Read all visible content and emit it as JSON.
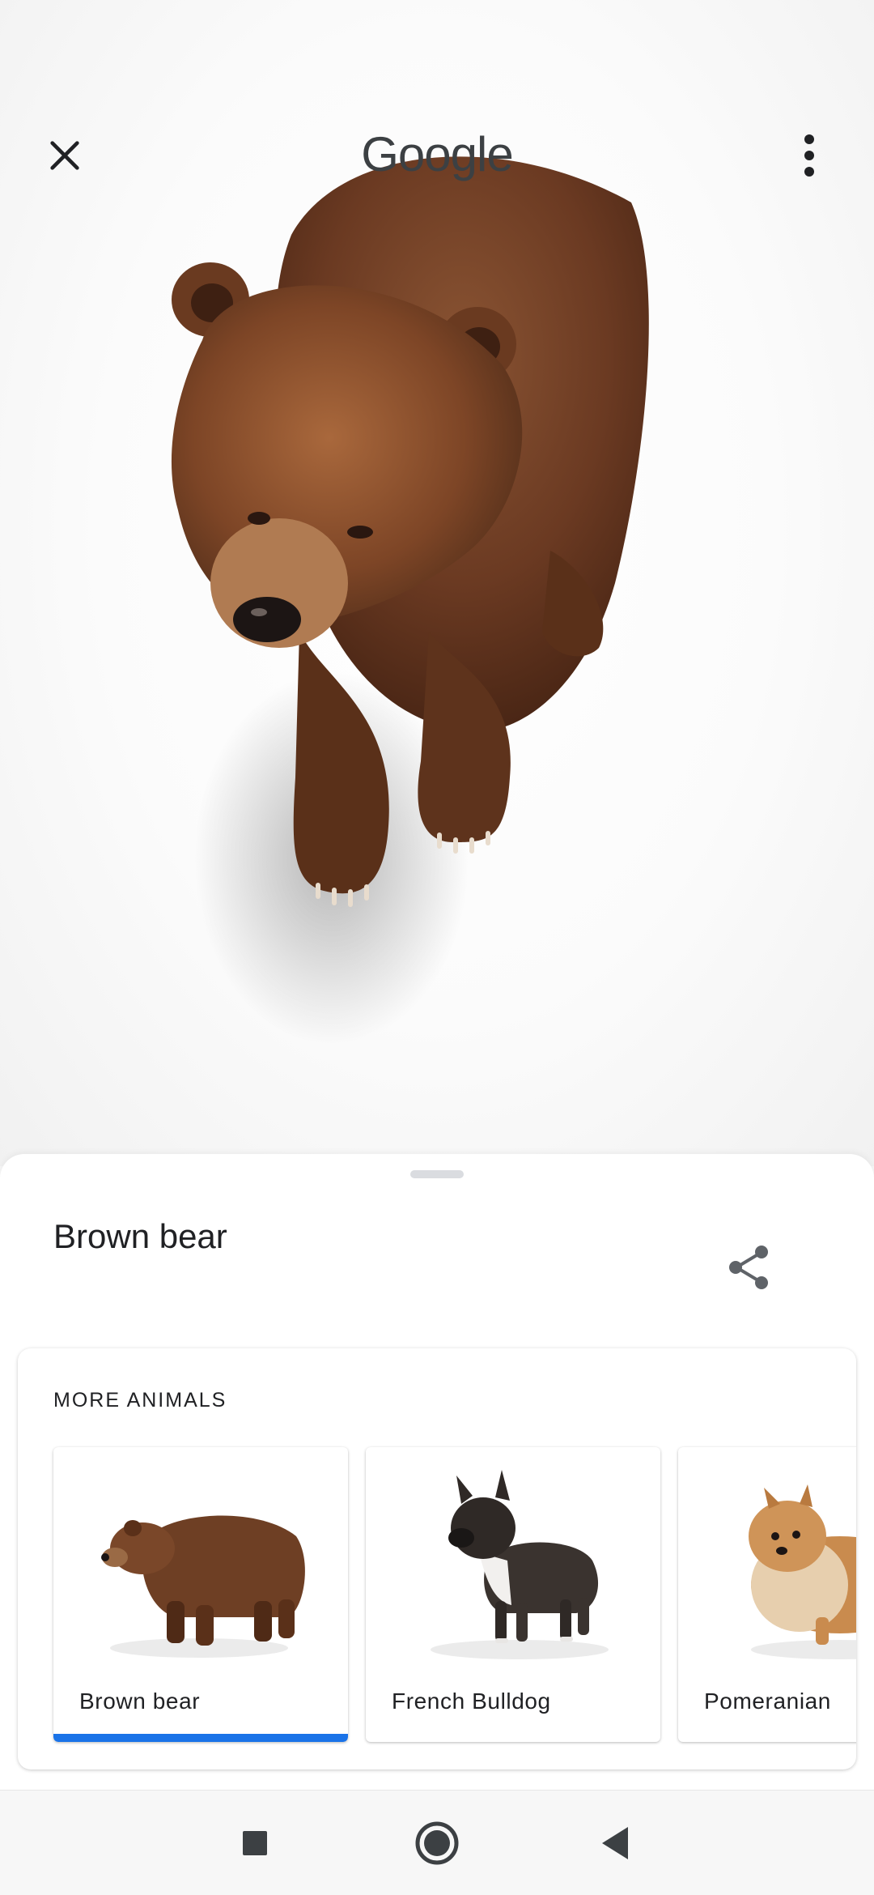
{
  "header": {
    "logo_text": "Google",
    "close_icon": "close-icon",
    "more_icon": "more-vert-icon"
  },
  "viewer": {
    "model_icon": "brown-bear-3d-model"
  },
  "sheet": {
    "title": "Brown bear",
    "share_icon": "share-icon",
    "more_animals": {
      "heading": "MORE ANIMALS",
      "items": [
        {
          "name": "Brown bear",
          "selected": true,
          "icon": "brown-bear-thumbnail"
        },
        {
          "name": "French Bulldog",
          "selected": false,
          "icon": "french-bulldog-thumbnail"
        },
        {
          "name": "Pomeranian",
          "selected": false,
          "icon": "pomeranian-thumbnail"
        }
      ]
    },
    "accent_color": "#1a73e8"
  },
  "nav": {
    "recents_icon": "recents-square-icon",
    "home_icon": "home-circle-icon",
    "back_icon": "back-triangle-icon"
  }
}
